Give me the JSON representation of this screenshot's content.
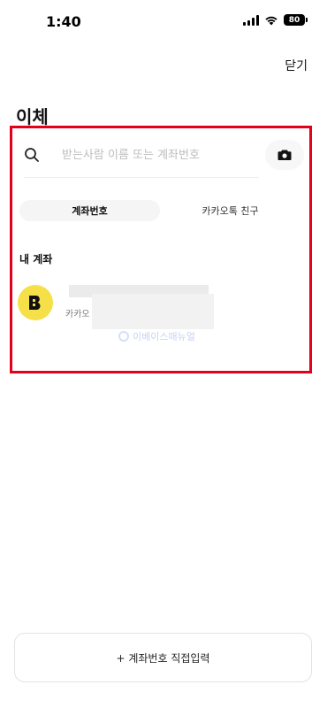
{
  "status_bar": {
    "time": "1:40",
    "battery": "80"
  },
  "header": {
    "close_label": "닫기",
    "title": "이체"
  },
  "search": {
    "placeholder": "받는사람 이름 또는 계좌번호"
  },
  "tabs": [
    {
      "label": "계좌번호",
      "active": true
    },
    {
      "label": "카카오톡 친구",
      "active": false
    }
  ],
  "my_accounts": {
    "section_label": "내 계좌",
    "items": [
      {
        "avatar_letter": "B",
        "name": "",
        "sub": "카카오"
      }
    ]
  },
  "watermark": {
    "text": "이베이스매뉴얼"
  },
  "footer": {
    "manual_input_label": "+ 계좌번호 직접입력"
  },
  "colors": {
    "highlight": "#e3001b",
    "avatar": "#f5e04a",
    "active_tab_bg": "#f5f5f5"
  },
  "icons": [
    "search-icon",
    "camera-icon",
    "signal-icon",
    "wifi-icon",
    "battery-icon"
  ]
}
